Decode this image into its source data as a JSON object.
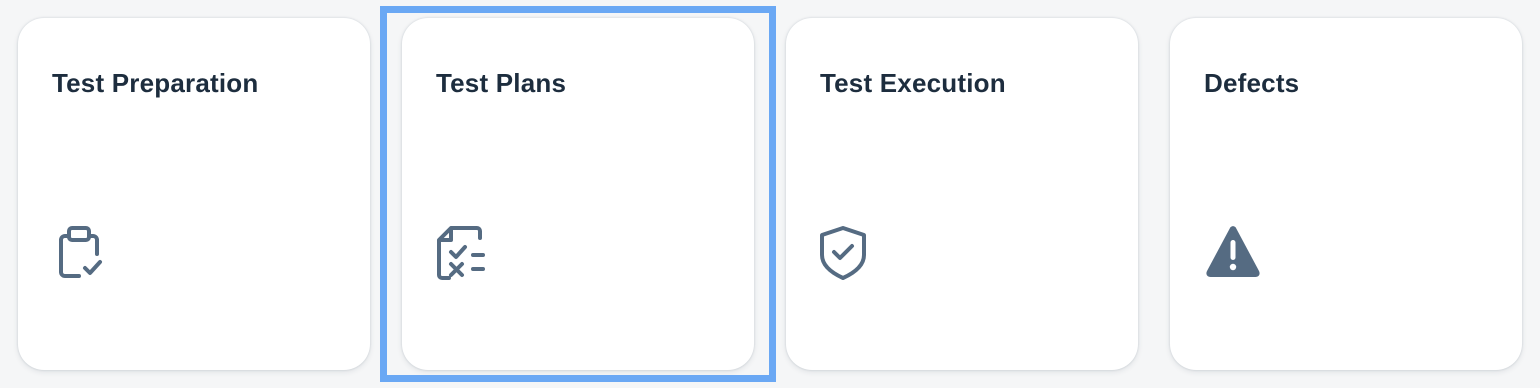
{
  "tiles": [
    {
      "title": "Test Preparation",
      "icon": "clipboard-check-icon"
    },
    {
      "title": "Test Plans",
      "icon": "checklist-document-icon"
    },
    {
      "title": "Test Execution",
      "icon": "shield-check-icon"
    },
    {
      "title": "Defects",
      "icon": "warning-icon"
    }
  ],
  "focused_tile": "Test Plans",
  "colors": {
    "background": "#f5f6f7",
    "tile": "#ffffff",
    "title": "#1d2d3e",
    "icon": "#556b82",
    "focus": "#6aa8f4"
  }
}
